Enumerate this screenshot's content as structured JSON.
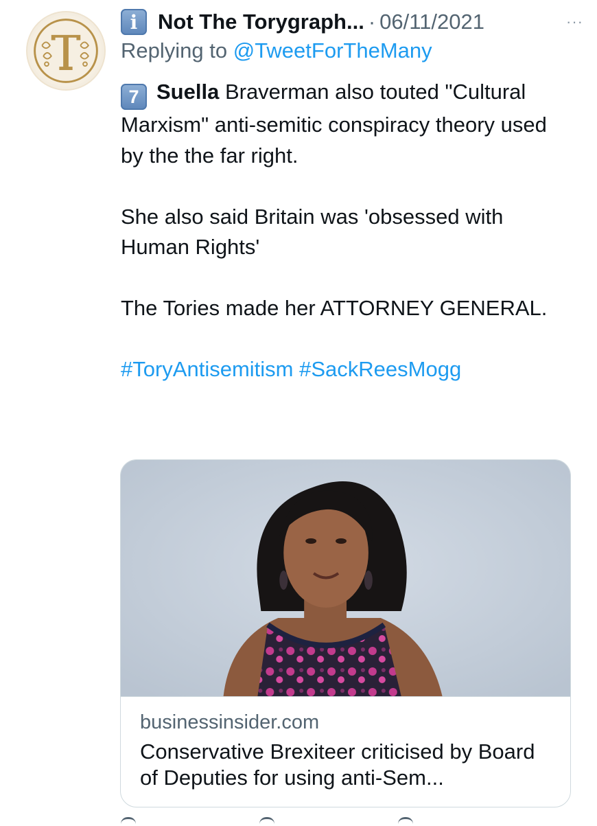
{
  "tweet": {
    "author_name": "Not The Torygraph...",
    "separator": "·",
    "date": "06/11/2021",
    "more_icon": "···",
    "reply_prefix": "Replying to",
    "reply_handle": "@TweetForTheMany",
    "badge_number": "7",
    "name_bold": "Suella",
    "line1_rest": " Braverman also touted \"Cultural Marxism\" anti-semitic conspiracy theory used by the the far right.",
    "paragraph2": "She also said Britain was 'obsessed with Human Rights'",
    "paragraph3": "The Tories made her ATTORNEY GENERAL.",
    "hashtags": [
      "#ToryAntisemitism",
      "#SackReesMogg"
    ]
  },
  "link_card": {
    "domain": "businessinsider.com",
    "title": "Conservative Brexiteer criticised by Board of Deputies for using anti-Sem..."
  },
  "colors": {
    "link": "#1d9bf0",
    "secondary_text": "#536471",
    "avatar_gold": "#b8924a"
  },
  "icons": {
    "emoji_key_icon": "information-source-keycap",
    "more_icon": "more-horizontal-icon"
  }
}
